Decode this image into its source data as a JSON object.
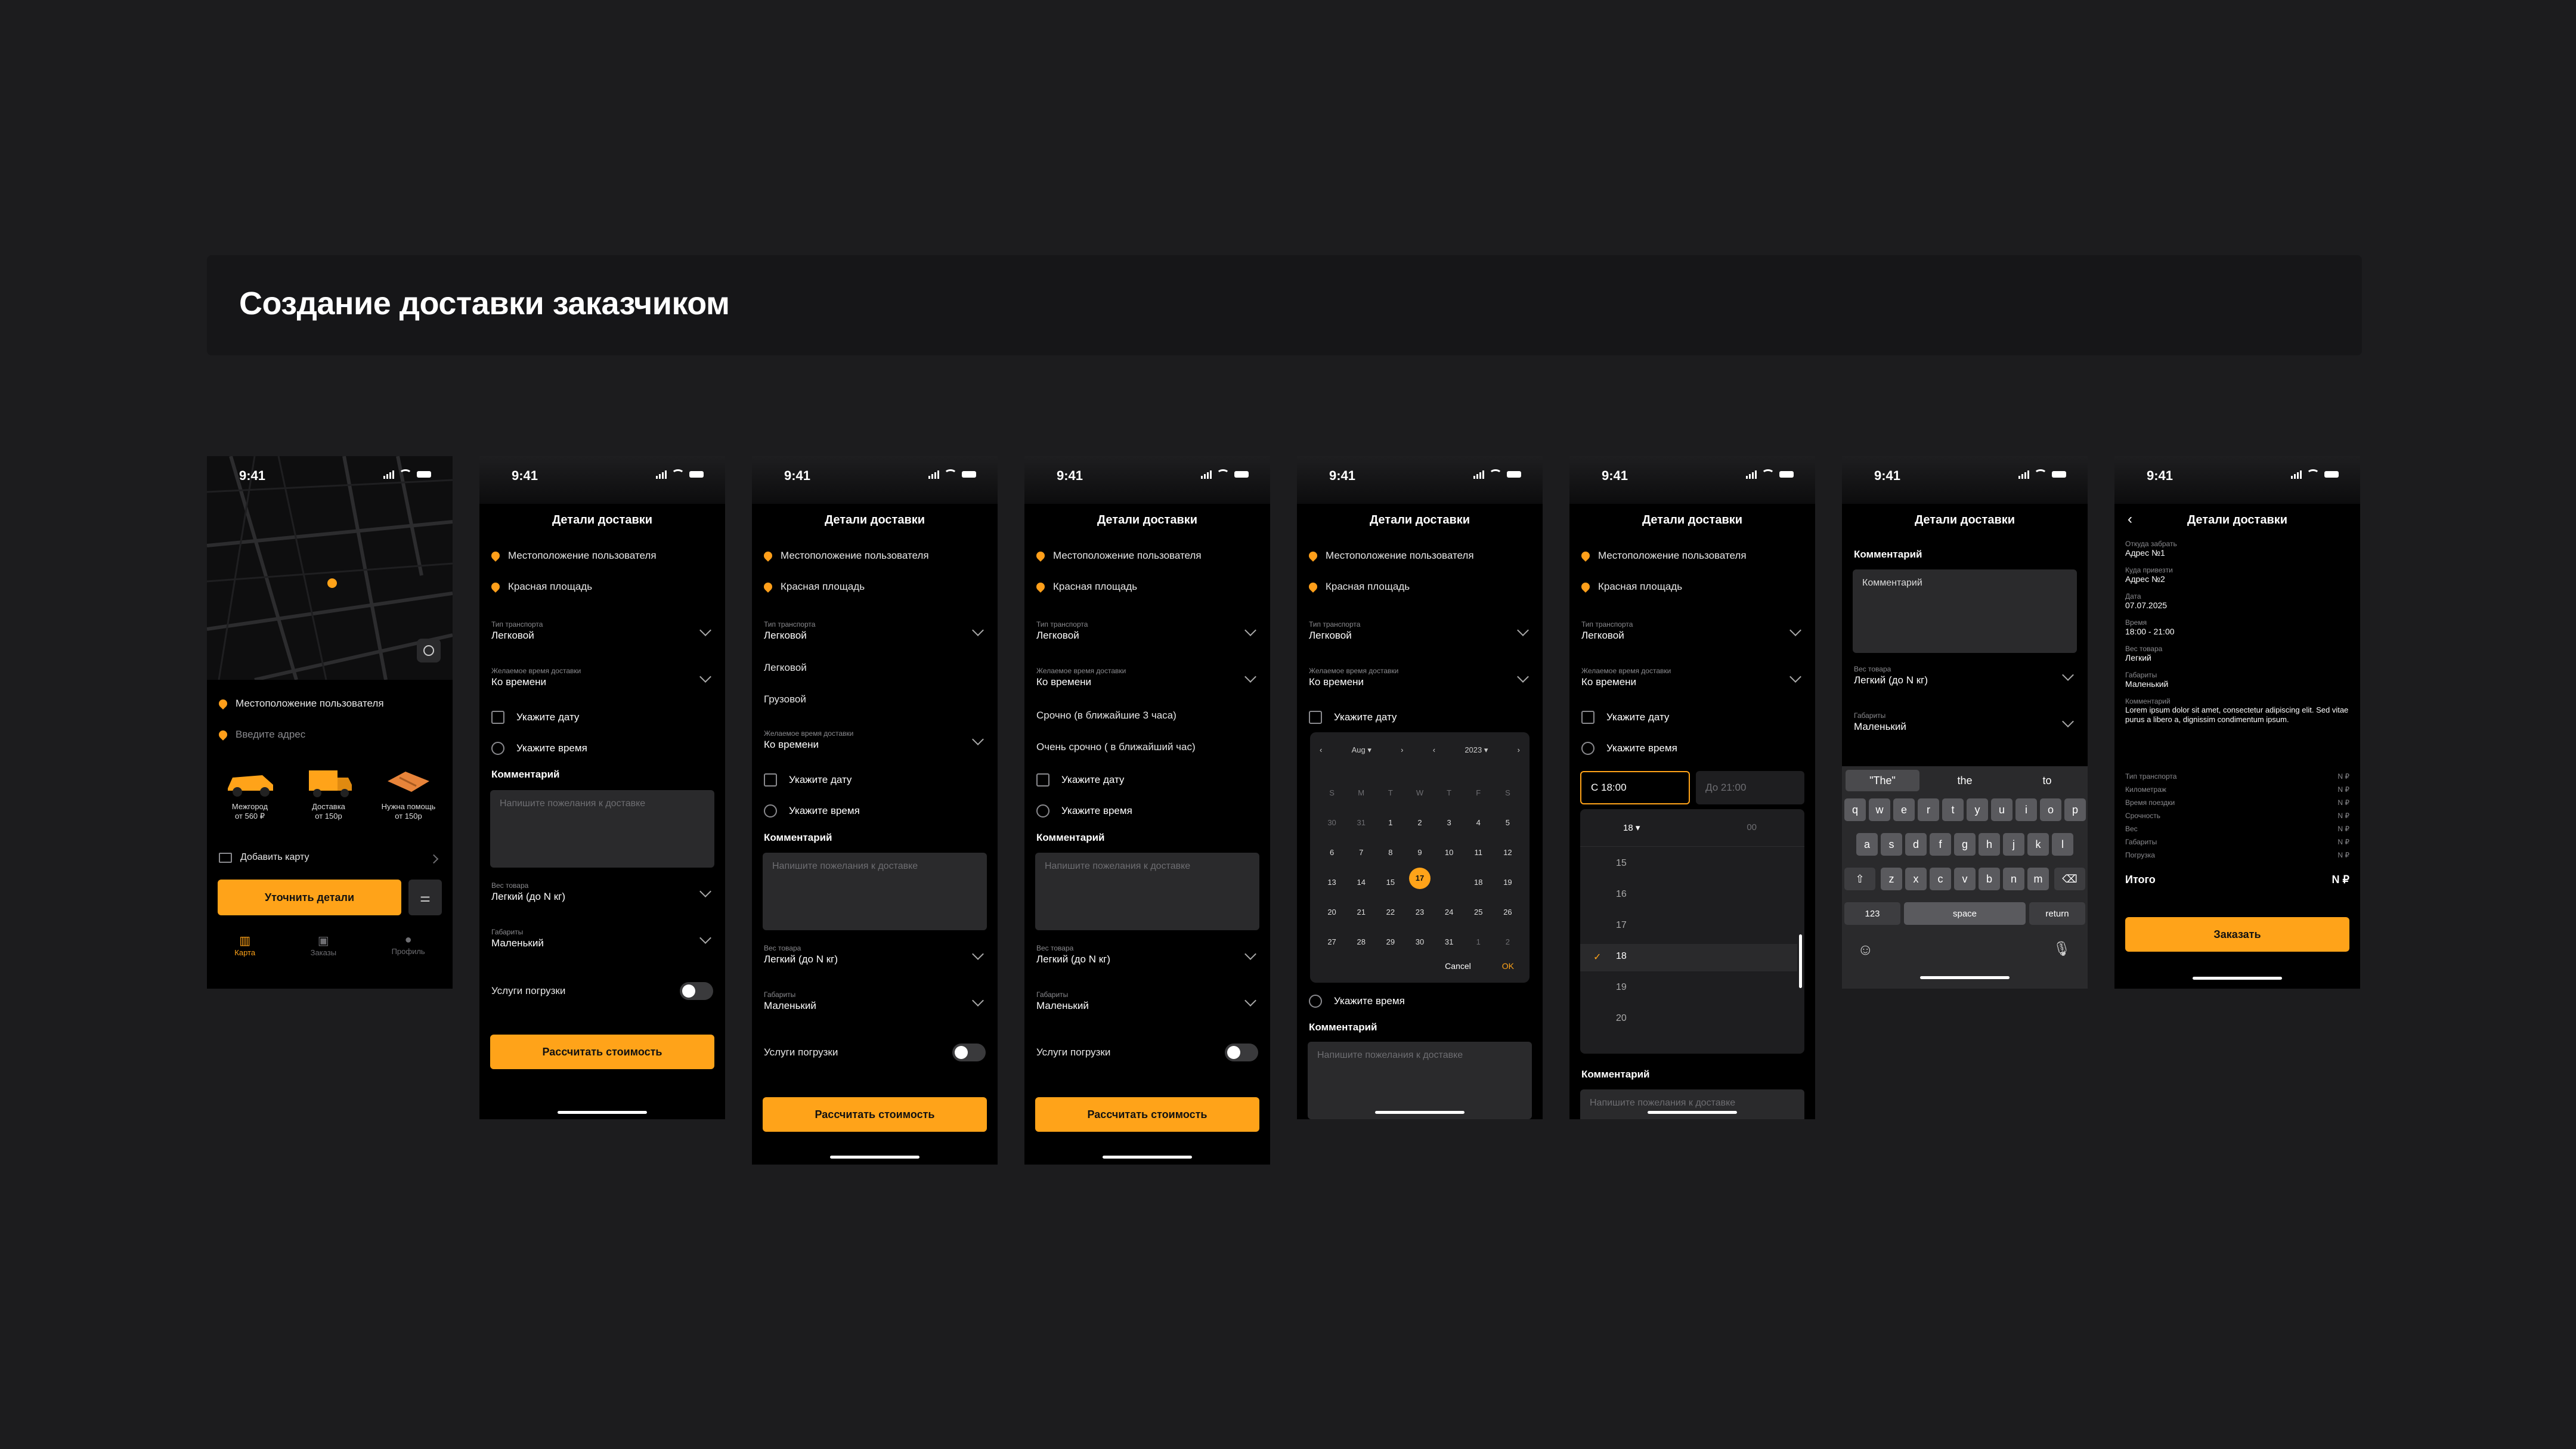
{
  "page_title": "Создание доставки заказчиком",
  "status_time": "9:41",
  "colors": {
    "accent": "#ffa319",
    "bg": "#1c1c1e",
    "screen": "#000000"
  },
  "header_title": "Детали доставки",
  "locations": {
    "user": "Местоположение пользователя",
    "dest": "Красная площадь",
    "enter": "Введите адрес"
  },
  "fields": {
    "transport_label": "Тип транспорта",
    "transport_value": "Легковой",
    "time_label": "Желаемое время доставки",
    "time_value": "Ко времени",
    "date": "Укажите дату",
    "time": "Укажите время",
    "comment_label": "Комментарий",
    "comment_placeholder": "Напишите пожелания к доставке",
    "weight_label": "Вес товара",
    "weight_value": "Легкий (до N кг)",
    "size_label": "Габариты",
    "size_value": "Маленький",
    "loading": "Услуги погрузки"
  },
  "transport_options": [
    "Легковой",
    "Грузовой"
  ],
  "time_options": [
    "Ко времени",
    "Срочно (в ближайшие 3 часа)",
    "Очень срочно ( в ближайший час)"
  ],
  "buttons": {
    "calc": "Рассчитать стоимость",
    "refine": "Уточнить детали",
    "order": "Заказать"
  },
  "screen1": {
    "cards": [
      {
        "title": "Межгород",
        "price": "от 560 ₽"
      },
      {
        "title": "Доставка",
        "price": "от 150р"
      },
      {
        "title": "Нужна помощь",
        "price": "от 150р"
      }
    ],
    "add_card": "Добавить карту",
    "tabs": [
      "Карта",
      "Заказы",
      "Профиль"
    ]
  },
  "calendar": {
    "month": "Aug",
    "year": "2023",
    "weekdays": [
      "S",
      "M",
      "T",
      "W",
      "T",
      "F",
      "S"
    ],
    "weeks": [
      [
        "30",
        "31",
        "1",
        "2",
        "3",
        "4",
        "5"
      ],
      [
        "6",
        "7",
        "8",
        "9",
        "10",
        "11",
        "12"
      ],
      [
        "13",
        "14",
        "15",
        "16",
        "17",
        "18",
        "19"
      ],
      [
        "20",
        "21",
        "22",
        "23",
        "24",
        "25",
        "26"
      ],
      [
        "27",
        "28",
        "29",
        "30",
        "31",
        "1",
        "2"
      ]
    ],
    "selected": "17",
    "cancel": "Cancel",
    "ok": "OK"
  },
  "time_picker": {
    "from": "С 18:00",
    "to": "До 21:00",
    "hour_selected": "18",
    "minute": "00",
    "hours": [
      "15",
      "16",
      "17",
      "18",
      "19",
      "20"
    ]
  },
  "keyboard": {
    "comment_value": "Комментарий",
    "suggestions": [
      "\"The\"",
      "the",
      "to"
    ],
    "row1": [
      "q",
      "w",
      "e",
      "r",
      "t",
      "y",
      "u",
      "i",
      "o",
      "p"
    ],
    "row2": [
      "a",
      "s",
      "d",
      "f",
      "g",
      "h",
      "j",
      "k",
      "l"
    ],
    "row3": [
      "z",
      "x",
      "c",
      "v",
      "b",
      "n",
      "m"
    ],
    "num": "123",
    "space": "space",
    "return": "return"
  },
  "summary": {
    "from_label": "Откуда забрать",
    "from_value": "Адрес №1",
    "to_label": "Куда привезти",
    "to_value": "Адрес №2",
    "date_label": "Дата",
    "date_value": "07.07.2025",
    "time_label": "Время",
    "time_value": "18:00 - 21:00",
    "weight_label": "Вес товара",
    "weight_value": "Легкий",
    "size_label": "Габариты",
    "size_value": "Маленький",
    "comment_label": "Комментарий",
    "comment_value": "Lorem ipsum dolor sit amet, consectetur adipiscing elit. Sed vitae purus a libero a, dignissim condimentum ipsum.",
    "lines": [
      {
        "k": "Тип транспорта",
        "v": "N ₽"
      },
      {
        "k": "Километраж",
        "v": "N ₽"
      },
      {
        "k": "Время поездки",
        "v": "N ₽"
      },
      {
        "k": "Срочность",
        "v": "N ₽"
      },
      {
        "k": "Вес",
        "v": "N ₽"
      },
      {
        "k": "Габариты",
        "v": "N ₽"
      },
      {
        "k": "Погрузка",
        "v": "N ₽"
      }
    ],
    "total_label": "Итого",
    "total_value": "N ₽"
  }
}
